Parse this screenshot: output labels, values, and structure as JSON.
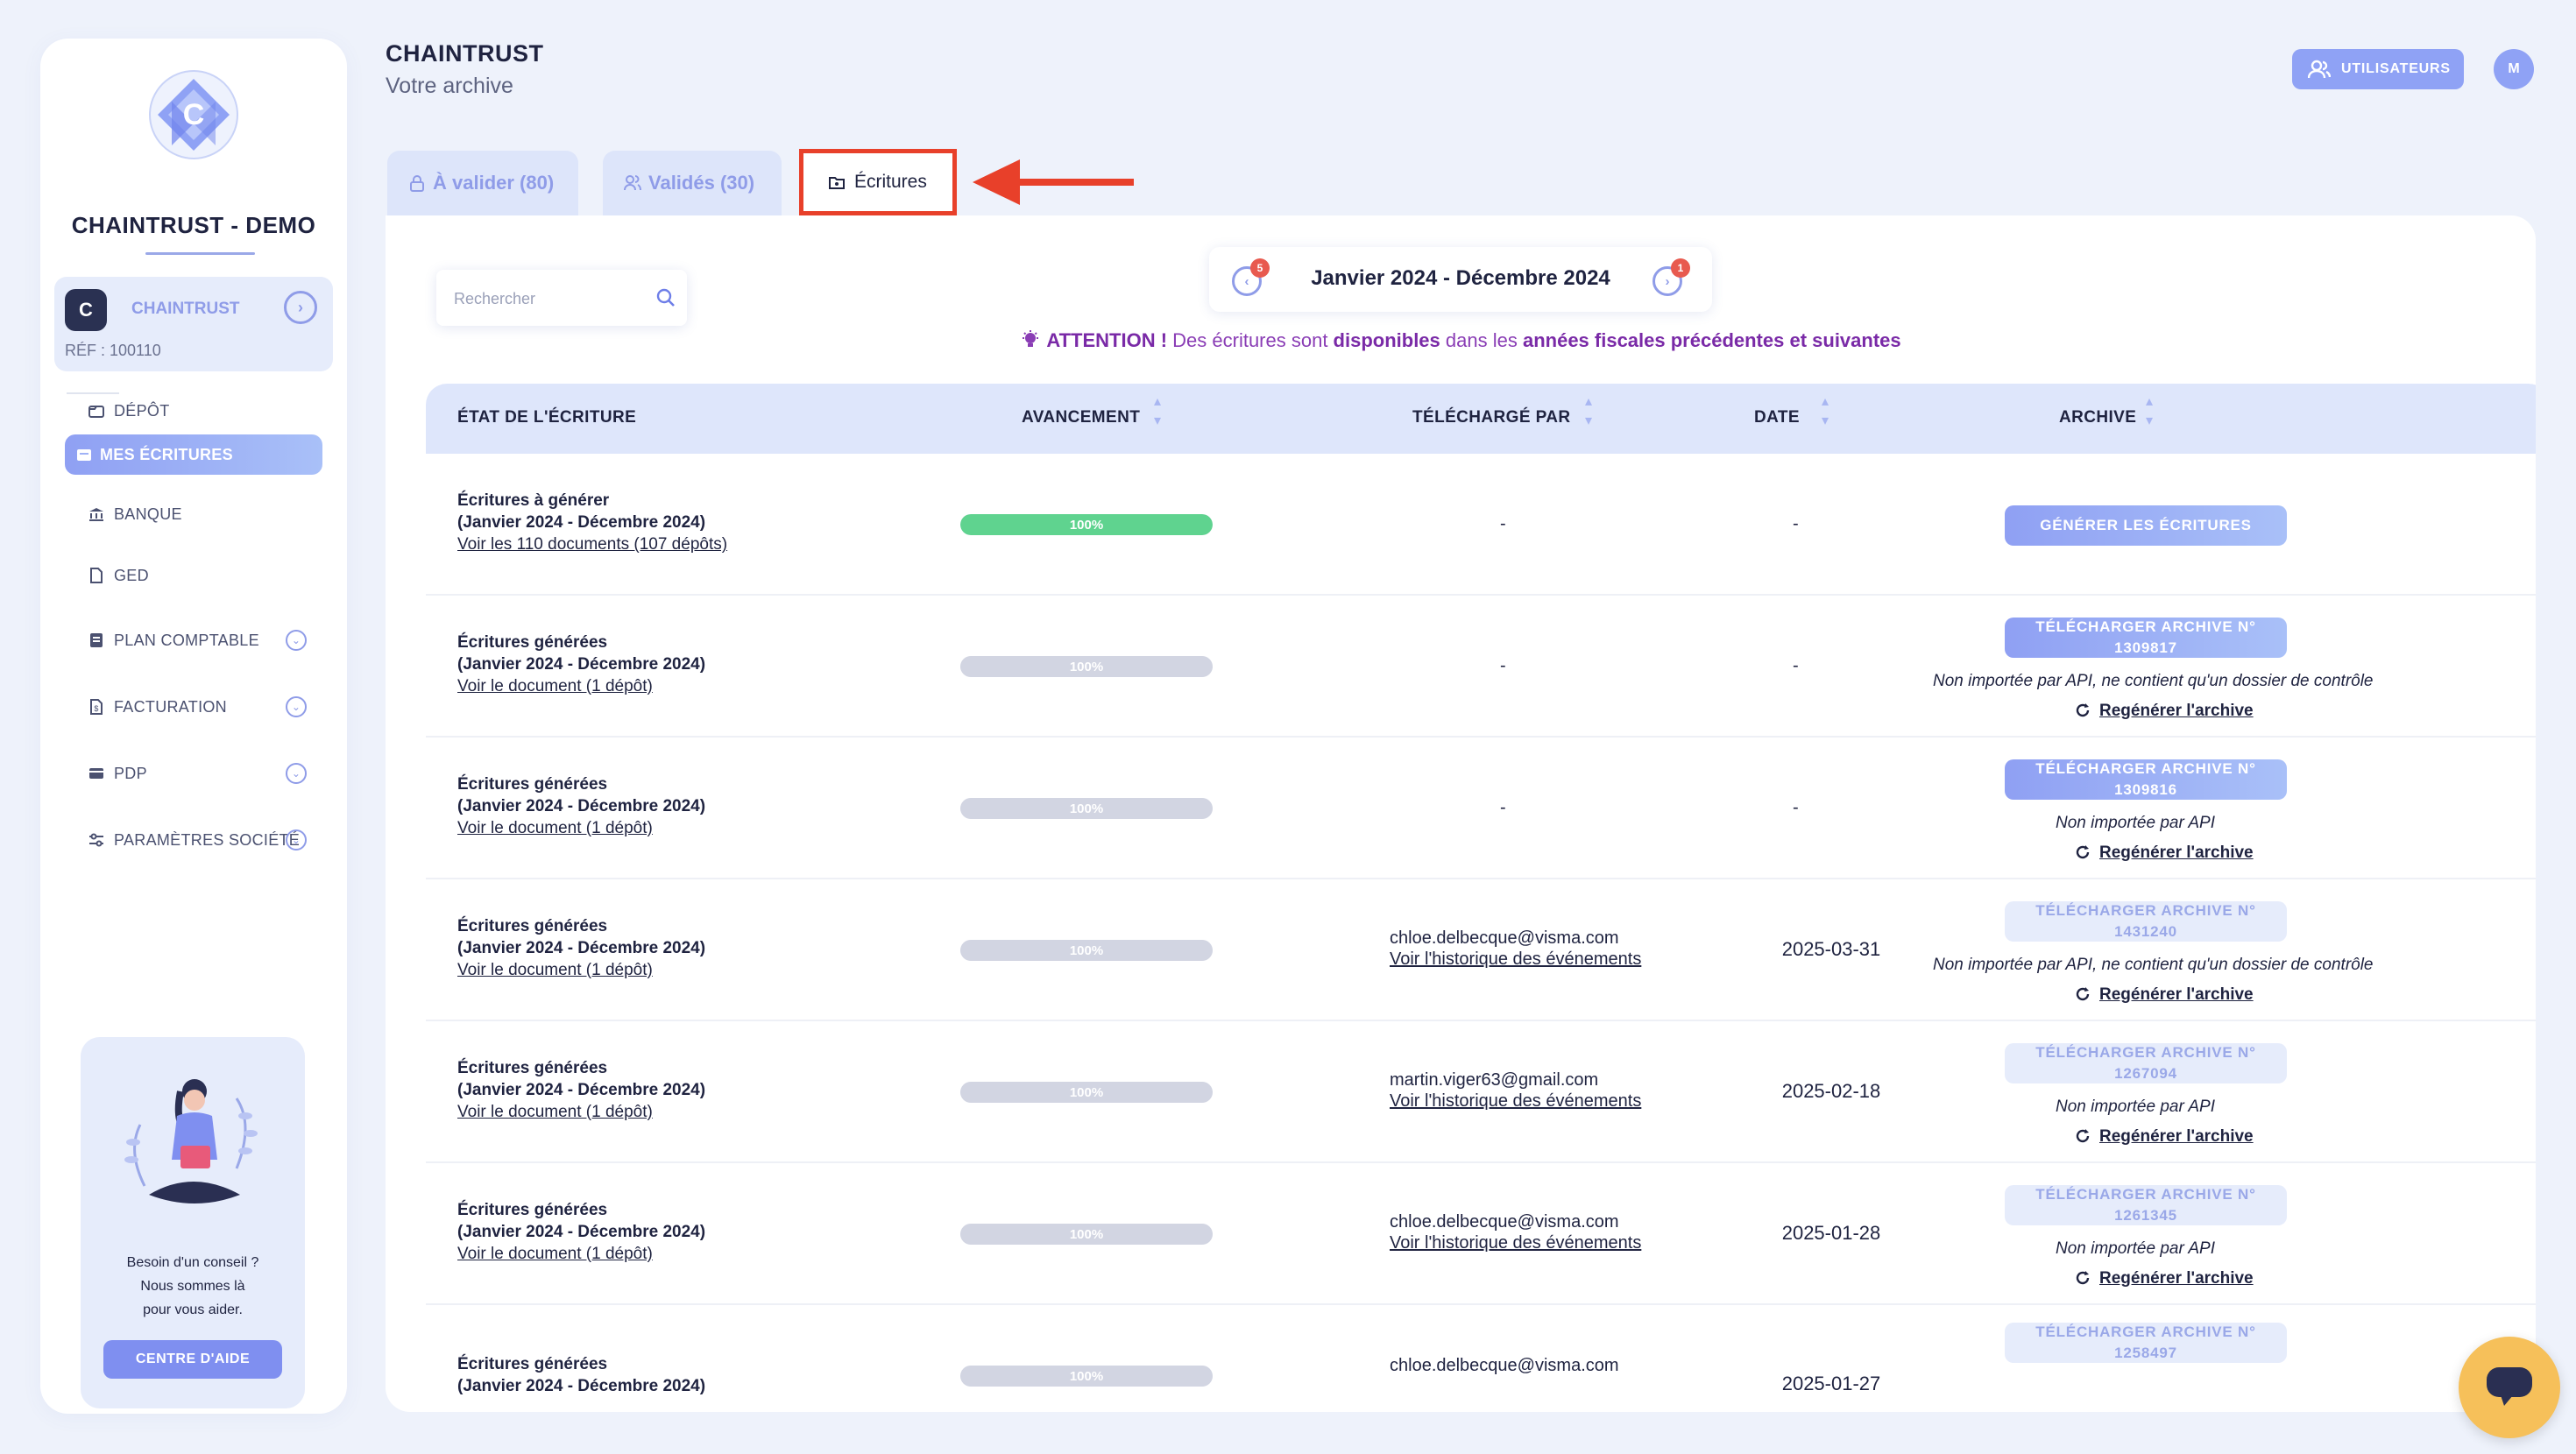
{
  "sidebar": {
    "org_name": "CHAINTRUST - DEMO",
    "company": {
      "name": "CHAINTRUST",
      "ref": "RÉF : 100110",
      "icon": "C"
    },
    "nav": [
      {
        "label": "DÉPÔT",
        "icon": "deposit-icon",
        "has_chevron": false
      },
      {
        "label": "MES ÉCRITURES",
        "icon": "entries-icon",
        "has_chevron": false,
        "active": true
      },
      {
        "label": "BANQUE",
        "icon": "bank-icon",
        "has_chevron": false
      },
      {
        "label": "GED",
        "icon": "document-icon",
        "has_chevron": false
      },
      {
        "label": "PLAN COMPTABLE",
        "icon": "ledger-icon",
        "has_chevron": true
      },
      {
        "label": "FACTURATION",
        "icon": "invoice-icon",
        "has_chevron": true
      },
      {
        "label": "PDP",
        "icon": "card-icon",
        "has_chevron": true
      },
      {
        "label": "PARAMÈTRES SOCIÉTÉ",
        "icon": "settings-sliders-icon",
        "has_chevron": true
      }
    ],
    "help": {
      "line1": "Besoin d'un conseil ?",
      "line2": "Nous sommes là",
      "line3": "pour vous aider.",
      "button": "CENTRE D'AIDE"
    }
  },
  "header": {
    "title": "CHAINTRUST",
    "subtitle": "Votre archive",
    "users_button": "UTILISATEURS",
    "avatar_initial": "M"
  },
  "tabs": [
    {
      "label": "À valider (80)",
      "icon": "lock-icon"
    },
    {
      "label": "Validés (30)",
      "icon": "users-icon"
    },
    {
      "label": "Écritures",
      "icon": "folder-icon",
      "active": true
    }
  ],
  "search": {
    "placeholder": "Rechercher",
    "value": ""
  },
  "period": {
    "label": "Janvier 2024 - Décembre 2024",
    "prev_badge": "5",
    "next_badge": "1"
  },
  "attention": {
    "prefix": "ATTENTION !",
    "t1": " Des écritures sont ",
    "b1": "disponibles",
    "t2": " dans les ",
    "b2": "années fiscales précédentes et suivantes"
  },
  "table": {
    "headers": {
      "status": "ÉTAT DE L'ÉCRITURE",
      "progress": "AVANCEMENT",
      "uploader": "TÉLÉCHARGÉ PAR",
      "date": "DATE",
      "archive": "ARCHIVE"
    },
    "rows": [
      {
        "title": "Écritures à générer",
        "period": "(Janvier 2024 - Décembre 2024)",
        "link": "Voir les 110 documents (107 dépôts)",
        "progress_label": "100%",
        "progress_value": 1.0,
        "progress_color": "green",
        "uploader": "-",
        "uploader_link": "",
        "date": "-",
        "archive_button": "GÉNÉRER LES ÉCRITURES",
        "archive_style": "primary",
        "note": "",
        "regen": "",
        "has_return": false
      },
      {
        "title": "Écritures générées",
        "period": "(Janvier 2024 - Décembre 2024)",
        "link": "Voir le document (1 dépôt)",
        "progress_label": "100%",
        "progress_value": 1.0,
        "progress_color": "grey",
        "uploader": "-",
        "uploader_link": "",
        "date": "-",
        "archive_button": "TÉLÉCHARGER ARCHIVE N° 1309817",
        "archive_style": "primary",
        "note": "Non importée par API, ne contient qu'un dossier de contrôle",
        "regen": "Regénérer l'archive",
        "has_return": true
      },
      {
        "title": "Écritures générées",
        "period": "(Janvier 2024 - Décembre 2024)",
        "link": "Voir le document (1 dépôt)",
        "progress_label": "100%",
        "progress_value": 1.0,
        "progress_color": "grey",
        "uploader": "-",
        "uploader_link": "",
        "date": "-",
        "archive_button": "TÉLÉCHARGER ARCHIVE N° 1309816",
        "archive_style": "primary",
        "note": "Non importée par API",
        "regen": "Regénérer l'archive",
        "has_return": true
      },
      {
        "title": "Écritures générées",
        "period": "(Janvier 2024 - Décembre 2024)",
        "link": "Voir le document (1 dépôt)",
        "progress_label": "100%",
        "progress_value": 1.0,
        "progress_color": "grey",
        "uploader": "chloe.delbecque@visma.com",
        "uploader_link": "Voir l'historique des événements",
        "date": "2025-03-31",
        "archive_button": "TÉLÉCHARGER ARCHIVE N° 1431240",
        "archive_style": "light",
        "note": "Non importée par API, ne contient qu'un dossier de contrôle",
        "regen": "Regénérer l'archive",
        "has_return": true
      },
      {
        "title": "Écritures générées",
        "period": "(Janvier 2024 - Décembre 2024)",
        "link": "Voir le document (1 dépôt)",
        "progress_label": "100%",
        "progress_value": 1.0,
        "progress_color": "grey",
        "uploader": "martin.viger63@gmail.com",
        "uploader_link": "Voir l'historique des événements",
        "date": "2025-02-18",
        "archive_button": "TÉLÉCHARGER ARCHIVE N° 1267094",
        "archive_style": "light",
        "note": "Non importée par API",
        "regen": "Regénérer l'archive",
        "has_return": true
      },
      {
        "title": "Écritures générées",
        "period": "(Janvier 2024 - Décembre 2024)",
        "link": "Voir le document (1 dépôt)",
        "progress_label": "100%",
        "progress_value": 1.0,
        "progress_color": "grey",
        "uploader": "chloe.delbecque@visma.com",
        "uploader_link": "Voir l'historique des événements",
        "date": "2025-01-28",
        "archive_button": "TÉLÉCHARGER ARCHIVE N° 1261345",
        "archive_style": "light",
        "note": "Non importée par API",
        "regen": "Regénérer l'archive",
        "has_return": true
      },
      {
        "title": "Écritures générées",
        "period": "(Janvier 2024 - Décembre 2024)",
        "link": "",
        "progress_label": "100%",
        "progress_value": 1.0,
        "progress_color": "grey",
        "uploader": "chloe.delbecque@visma.com",
        "uploader_link": "",
        "date": "2025-01-27",
        "archive_button": "TÉLÉCHARGER ARCHIVE N° 1258497",
        "archive_style": "light",
        "note": "",
        "regen": "",
        "has_return": true
      }
    ]
  },
  "colors": {
    "accent": "#8f9ce8",
    "annotation": "#e8402a",
    "success": "#5fd38f",
    "chat": "#f6c05a"
  }
}
